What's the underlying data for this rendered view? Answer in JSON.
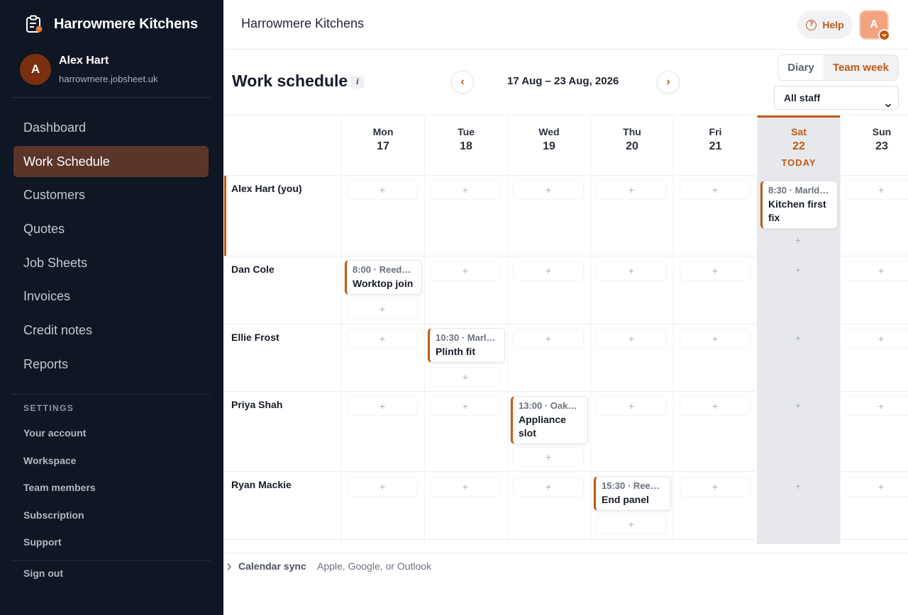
{
  "sidebar": {
    "brand": "Harrowmere Kitchens",
    "user": {
      "initial": "A",
      "name": "Alex Hart",
      "email": "harrowmere.jobsheet.uk"
    },
    "nav": [
      "Dashboard",
      "Work Schedule",
      "Customers",
      "Quotes",
      "Job Sheets",
      "Invoices",
      "Credit notes",
      "Reports"
    ],
    "active_nav": "Work Schedule",
    "settings_heading": "SETTINGS",
    "settings": [
      "Your account",
      "Workspace",
      "Team members",
      "Subscription",
      "Support"
    ],
    "sign_out": "Sign out"
  },
  "topbar": {
    "title": "Harrowmere Kitchens",
    "help": "Help",
    "avatar_initial": "A"
  },
  "schedule": {
    "heading": "Work schedule",
    "info": "i",
    "prev": "‹",
    "next": "›",
    "range": "17 Aug – 23 Aug, 2026",
    "view_diary": "Diary",
    "view_team": "Team week",
    "staff_filter": "All staff",
    "days": [
      {
        "dow": "Mon",
        "num": "17"
      },
      {
        "dow": "Tue",
        "num": "18"
      },
      {
        "dow": "Wed",
        "num": "19"
      },
      {
        "dow": "Thu",
        "num": "20"
      },
      {
        "dow": "Fri",
        "num": "21"
      },
      {
        "dow": "Sat",
        "num": "22"
      },
      {
        "dow": "Sun",
        "num": "23"
      }
    ],
    "today_label": "TODAY",
    "add_glyph": "+",
    "staff": [
      "Alex Hart (you)",
      "Dan Cole",
      "Ellie Frost",
      "Priya Shah",
      "Ryan Mackie"
    ],
    "appointments": [
      {
        "meta": "8:30 · Marld…",
        "title": "Kitchen first fix"
      },
      {
        "meta": "8:00 · Reed…",
        "title": "Worktop join"
      },
      {
        "meta": "10:30 · Marl…",
        "title": "Plinth fit"
      },
      {
        "meta": "13:00 · Oak…",
        "title": "Appliance slot"
      },
      {
        "meta": "15:30 · Reed…",
        "title": "End panel"
      }
    ]
  },
  "footer": {
    "label": "Calendar sync",
    "sub": "Apple, Google, or Outlook"
  },
  "colors": {
    "accent": "#c05a12",
    "sidebar_bg": "#0f1624",
    "active_nav_bg": "#5a3528"
  }
}
